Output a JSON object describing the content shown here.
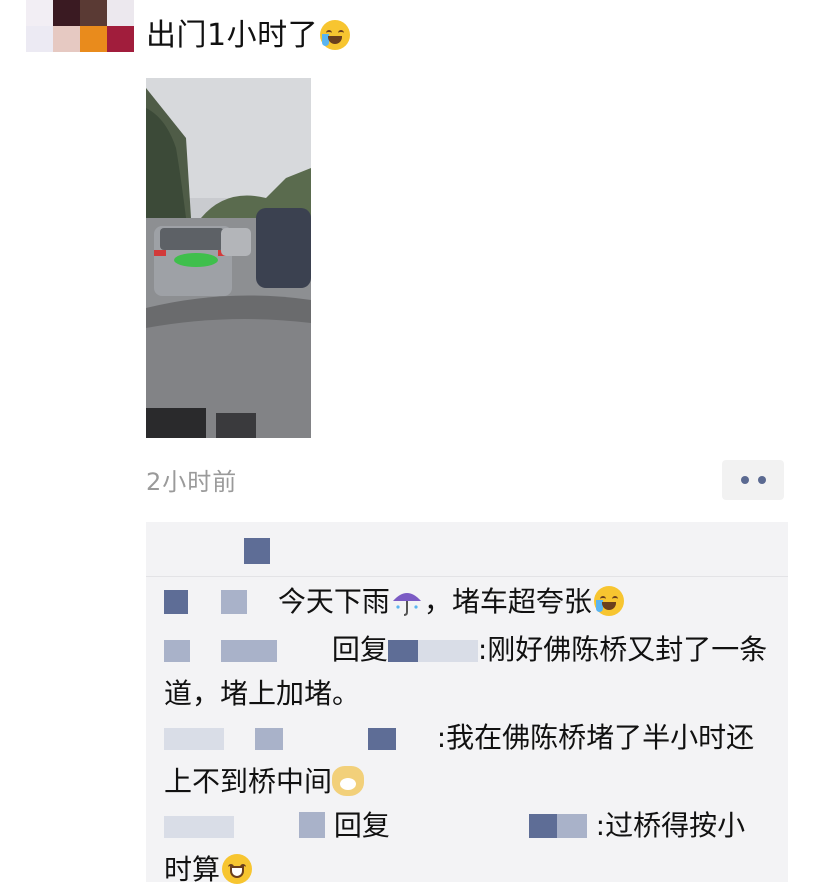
{
  "post": {
    "text": "出门1小时了",
    "emoji_icon": "laughing-tears-emoji",
    "photo_description_icon": "traffic-jam-photo",
    "timestamp": "2小时前"
  },
  "colors": {
    "link_blue": "#5b6a91",
    "comment_bg": "#f3f3f5",
    "timestamp_gray": "#9a9a9a"
  },
  "comments": [
    {
      "text_before": "今天下雨",
      "text_after": "，堵车超夸张",
      "icons": [
        "umbrella-rain-emoji",
        "laughing-tears-emoji"
      ]
    },
    {
      "reply_label": "回复",
      "separator": ":",
      "text": "刚好佛陈桥又封了一条道，堵上加堵。"
    },
    {
      "separator": ":",
      "text": "我在佛陈桥堵了半小时还上不到桥中间",
      "icons": [
        "dog-face-emoji"
      ]
    },
    {
      "reply_label": "回复",
      "separator": ":",
      "text": "过桥得按小时算",
      "icons": [
        "grin-emoji"
      ]
    }
  ]
}
